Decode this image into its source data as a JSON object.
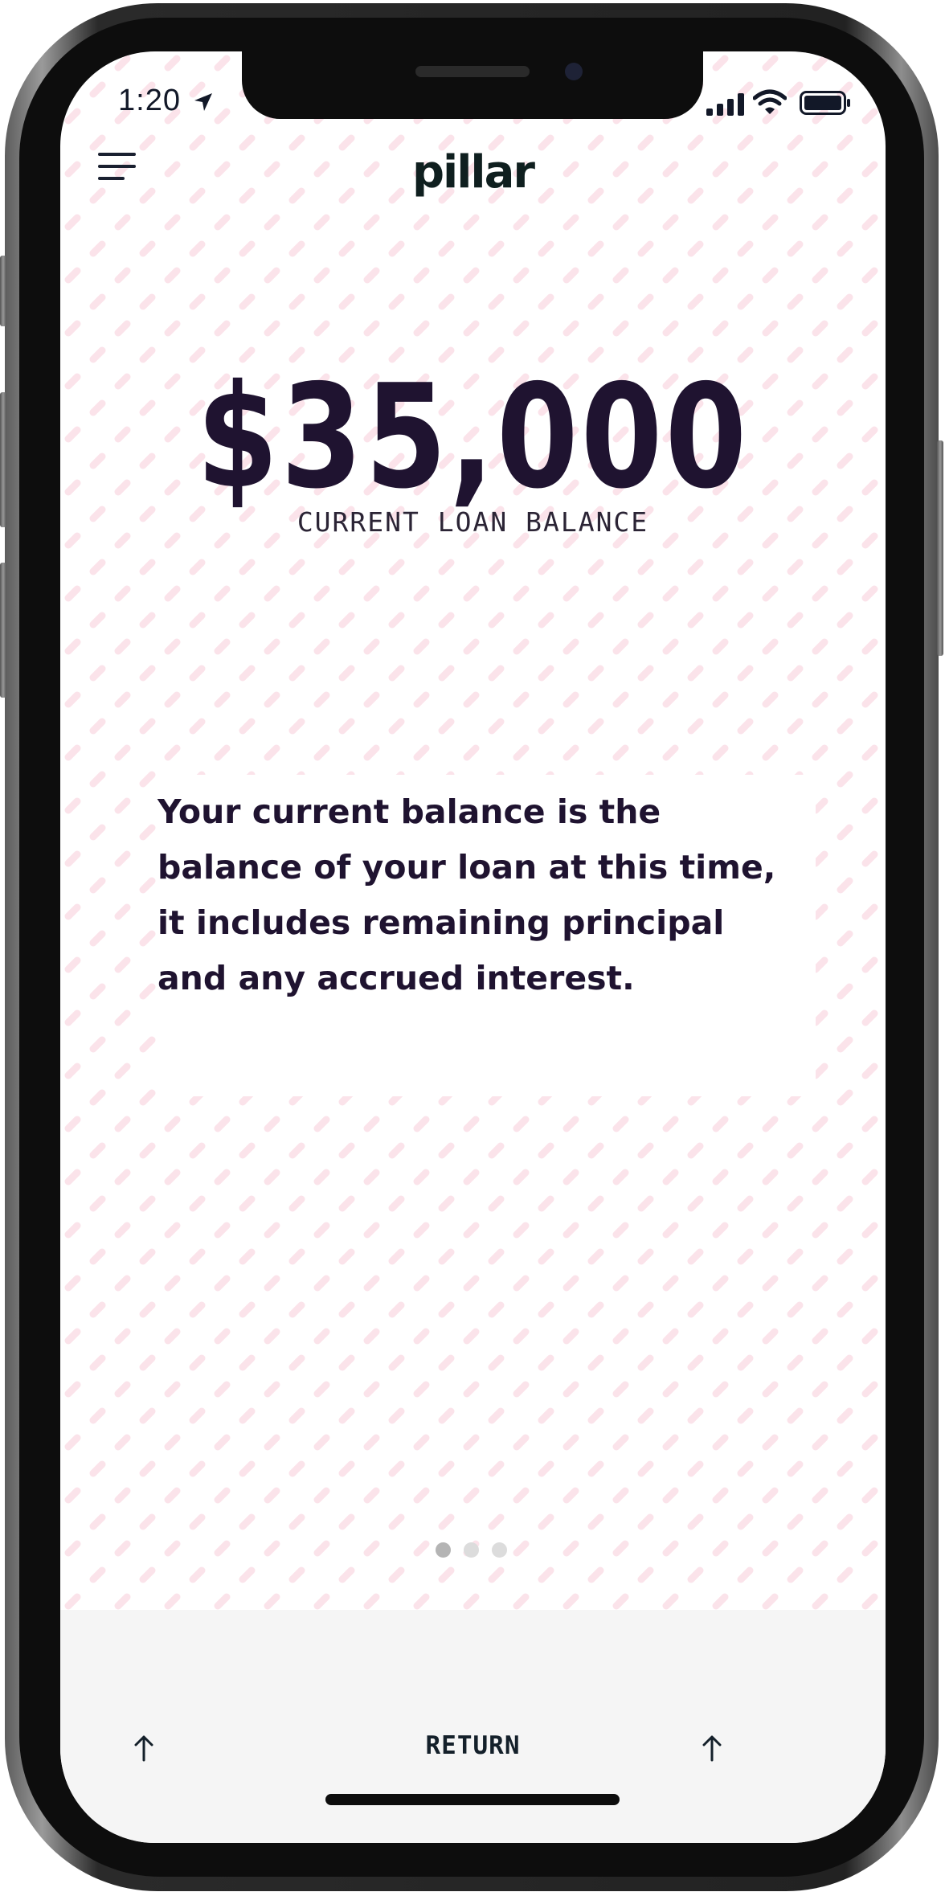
{
  "status_bar": {
    "time": "1:20"
  },
  "header": {
    "brand": "pillar"
  },
  "balance": {
    "amount": "$35,000",
    "label": "CURRENT LOAN BALANCE"
  },
  "description": "Your current balance is the balance of your loan at this time, it includes remaining principal and any accrued interest.",
  "pagination": {
    "total": 3,
    "active_index": 0
  },
  "bottom_bar": {
    "return_label": "RETURN",
    "left_icon": "arrow-up-icon",
    "right_icon": "arrow-up-icon"
  },
  "colors": {
    "text_dark": "#1f1330",
    "pattern_pink": "#fbe3ea",
    "bottom_bar_bg": "#f5f5f5"
  }
}
